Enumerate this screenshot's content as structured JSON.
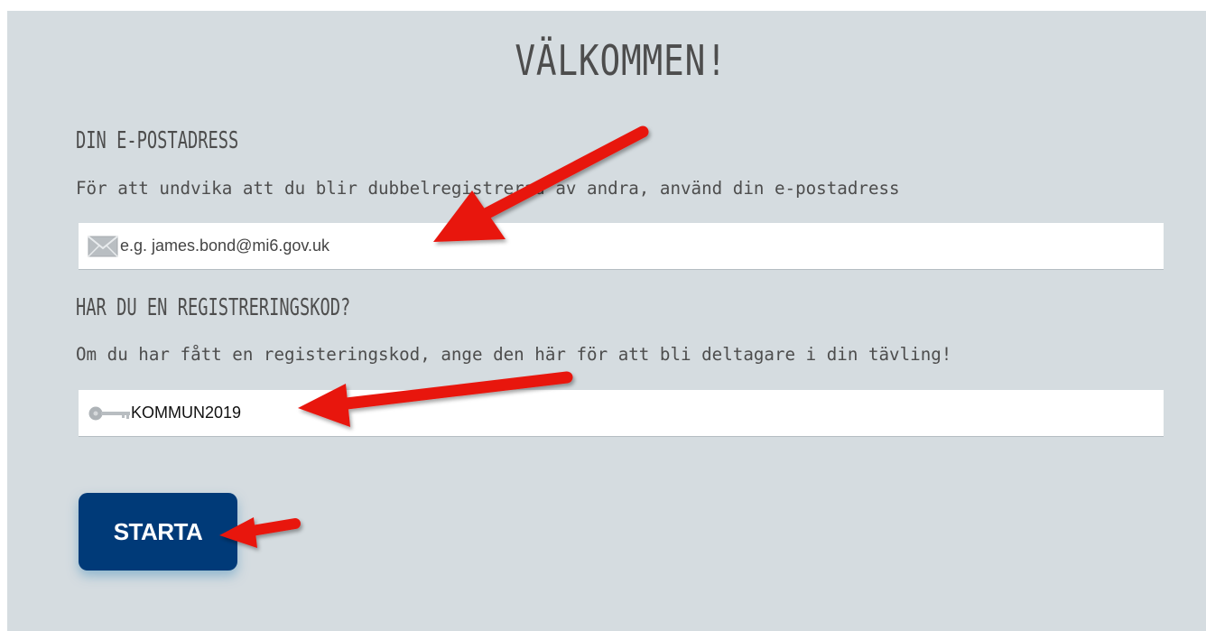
{
  "page": {
    "title": "VÄLKOMMEN!"
  },
  "email_section": {
    "heading": "DIN E-POSTADRESS",
    "description": "För att undvika att du blir dubbelregistrerad av andra, använd din e-postadress",
    "placeholder": "e.g. james.bond@mi6.gov.uk",
    "icon": "envelope-icon"
  },
  "code_section": {
    "heading": "HAR DU EN REGISTRERINGSKOD?",
    "description": "Om du har fått en registeringskod, ange den här för att bli deltagare i din tävling!",
    "value": "KOMMUN2019",
    "icon": "key-icon"
  },
  "actions": {
    "start_label": "STARTA"
  },
  "colors": {
    "panel_background": "#d5dce0",
    "button_background": "#003a78",
    "annotation_arrow": "#e8140c"
  }
}
